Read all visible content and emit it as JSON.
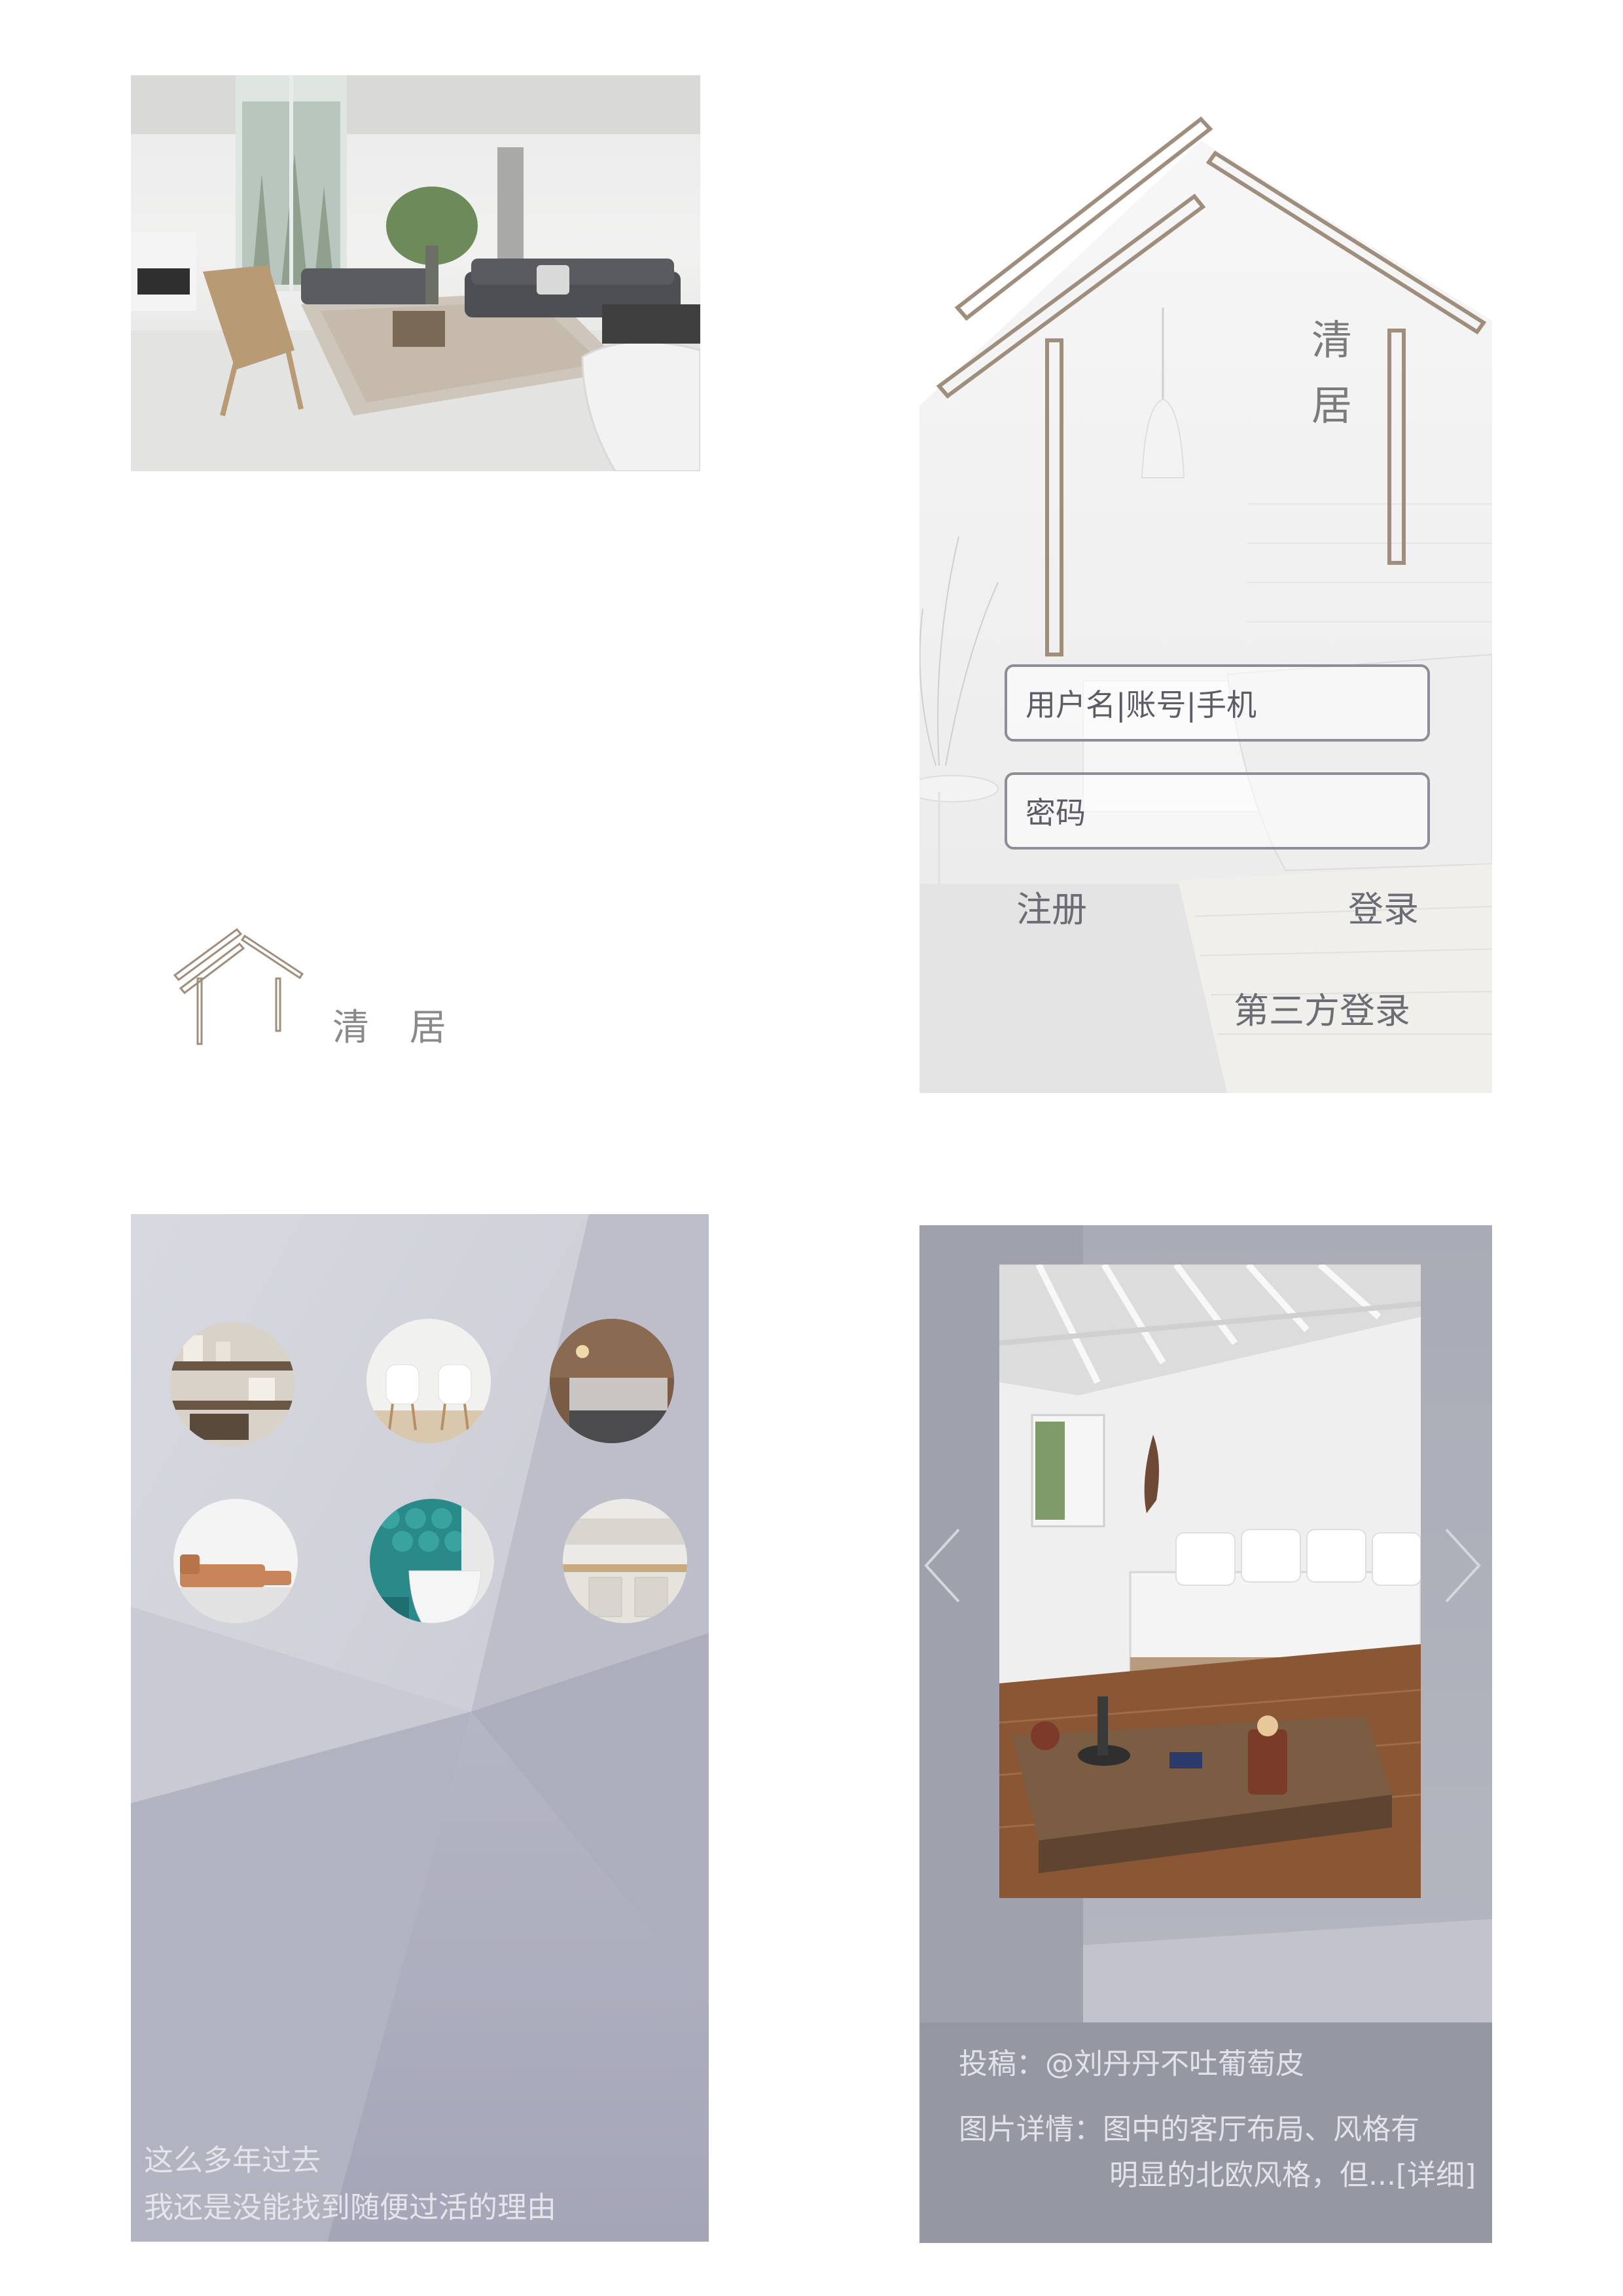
{
  "brand": {
    "name": "清 居",
    "accent_color": "#a08e7c"
  },
  "login": {
    "title_chars": [
      "清",
      "居"
    ],
    "username_placeholder": "用户名|账号|手机",
    "password_placeholder": "密码",
    "register_label": "注册",
    "login_label": "登录",
    "third_party_label": "第三方登录"
  },
  "categories": {
    "icons": [
      "shelf-photo-icon",
      "dining-photo-icon",
      "bedroom-photo-icon",
      "sofa-photo-icon",
      "bathroom-photo-icon",
      "kitchen-photo-icon"
    ],
    "quote_line_1": "这么多年过去",
    "quote_line_2": "我还是没能找到随便过活的理由"
  },
  "detail": {
    "contributor": "投稿：@刘丹丹不吐葡萄皮",
    "description_line_1": "图片详情：图中的客厅布局、风格有",
    "description_line_2": "明显的北欧风格，但...[详细]",
    "prev_icon": "chevron-left-icon",
    "next_icon": "chevron-right-icon"
  },
  "colors": {
    "panel_gray": "#c6c8d3",
    "panel_dark": "#9597a3",
    "text_light": "#e2e3ea"
  }
}
